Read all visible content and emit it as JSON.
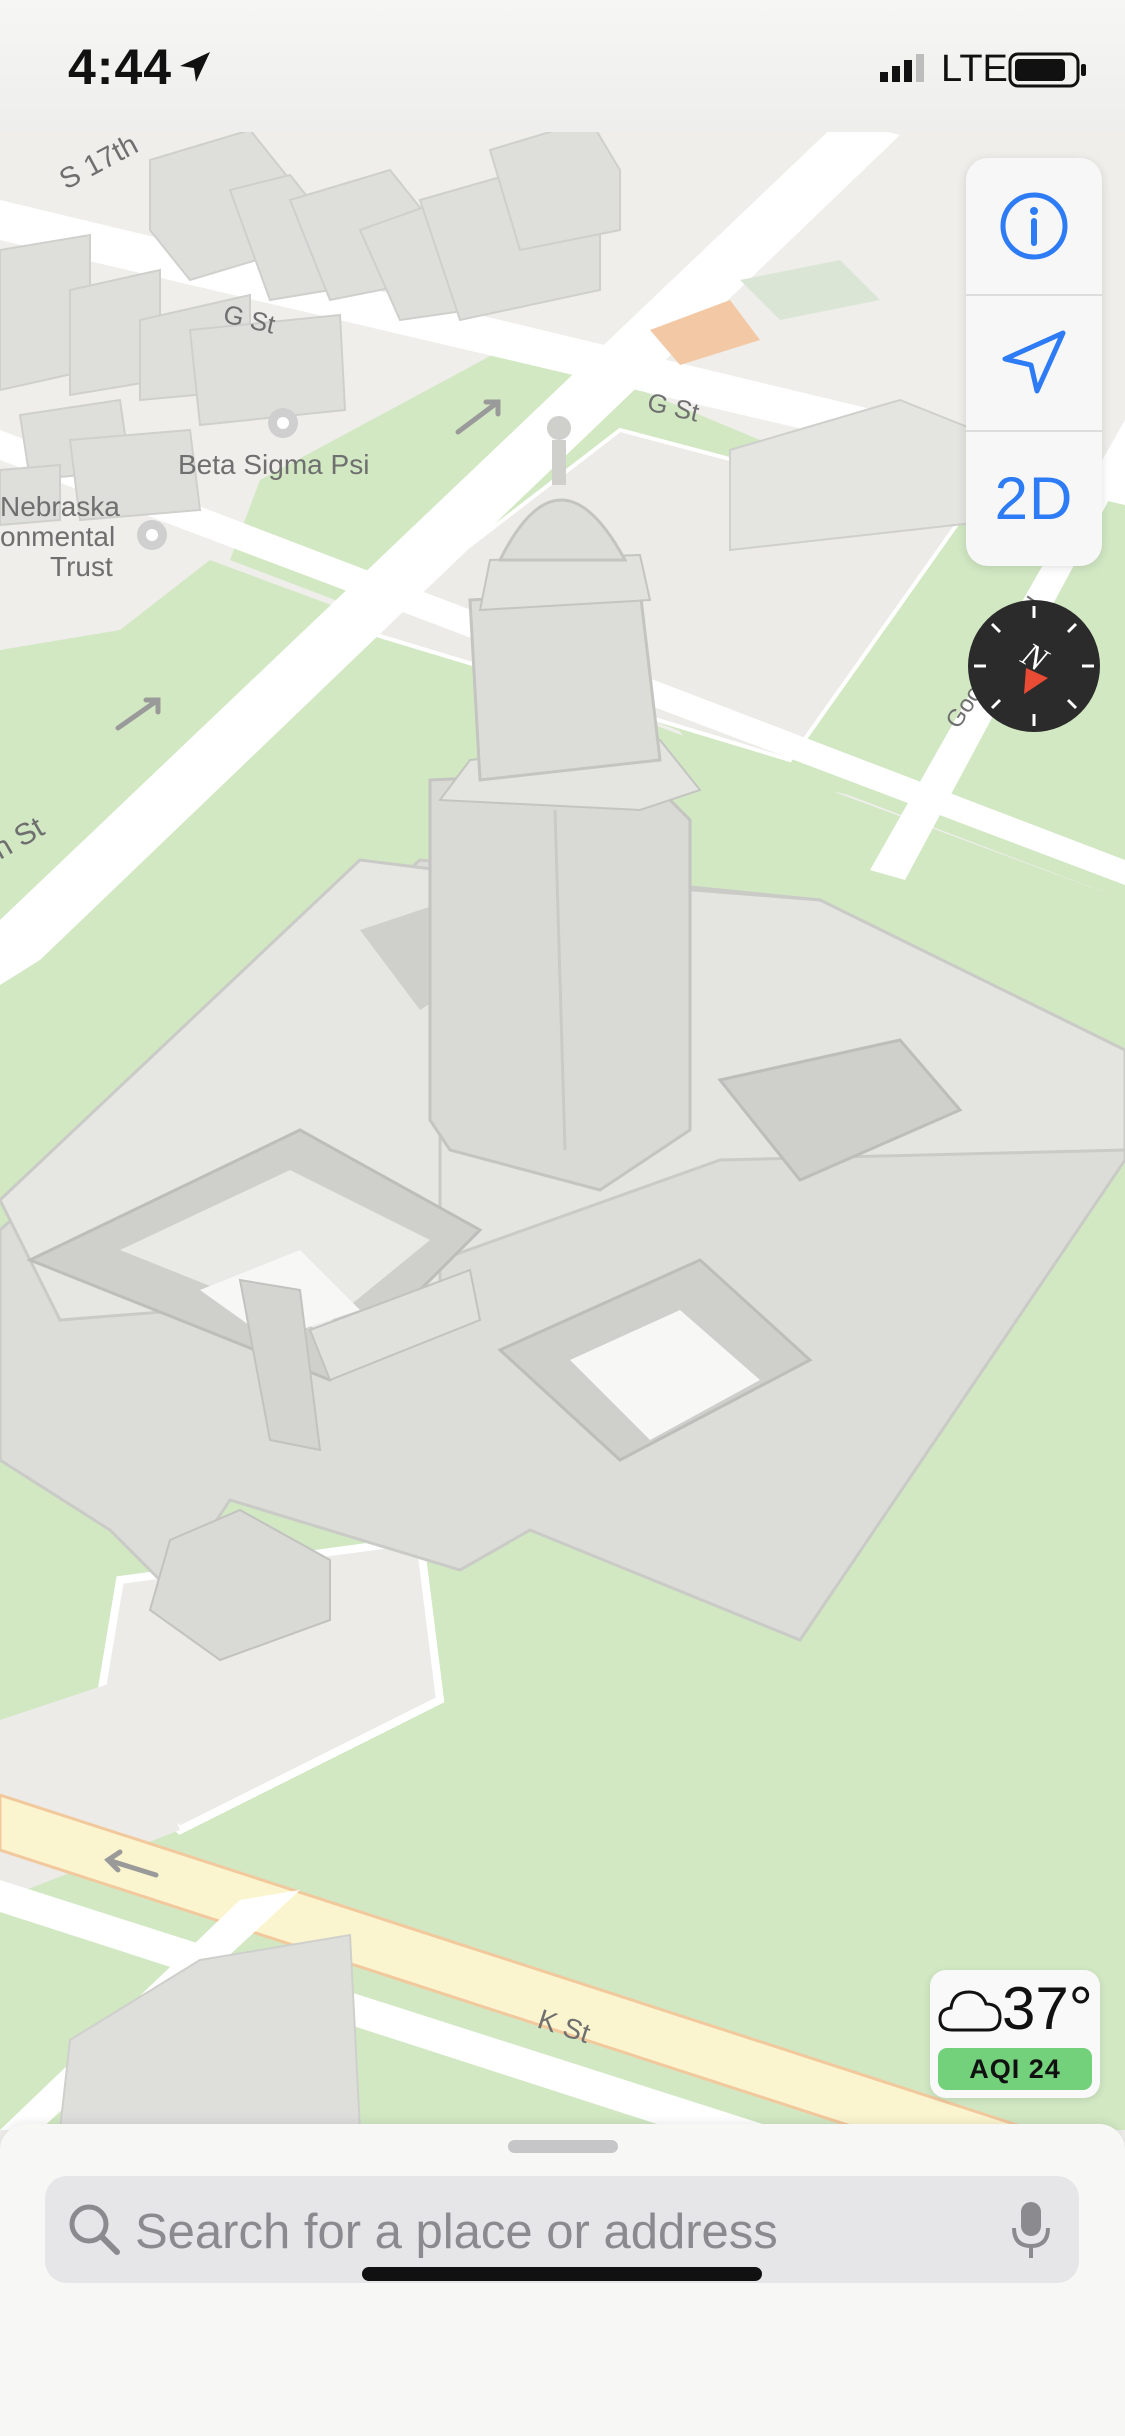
{
  "status_bar": {
    "time": "4:44",
    "network": "LTE"
  },
  "map": {
    "labels": {
      "s17th": "S 17th",
      "g_st_1": "G St",
      "g_st_2": "G St",
      "beta_sigma_psi": "Beta Sigma Psi",
      "nebraska": "Nebraska",
      "onmental": "onmental",
      "trust": "Trust",
      "n_st": "n St",
      "goodhue": "Goodhue Blvd",
      "k_st": "K St"
    }
  },
  "controls": {
    "info_icon": "info-circle-icon",
    "location_icon": "location-arrow-icon",
    "view_toggle": "2D",
    "compass_letter": "N"
  },
  "weather": {
    "temperature": "37°",
    "aqi": "AQI 24",
    "icon": "cloud-icon"
  },
  "search": {
    "placeholder": "Search for a place or address",
    "search_icon": "magnifier-icon",
    "mic_icon": "microphone-icon"
  },
  "colors": {
    "accent": "#2d7bf5",
    "park": "#cfe7c0",
    "road_major": "#fbf5cf",
    "aqi_good": "#73d07b"
  }
}
